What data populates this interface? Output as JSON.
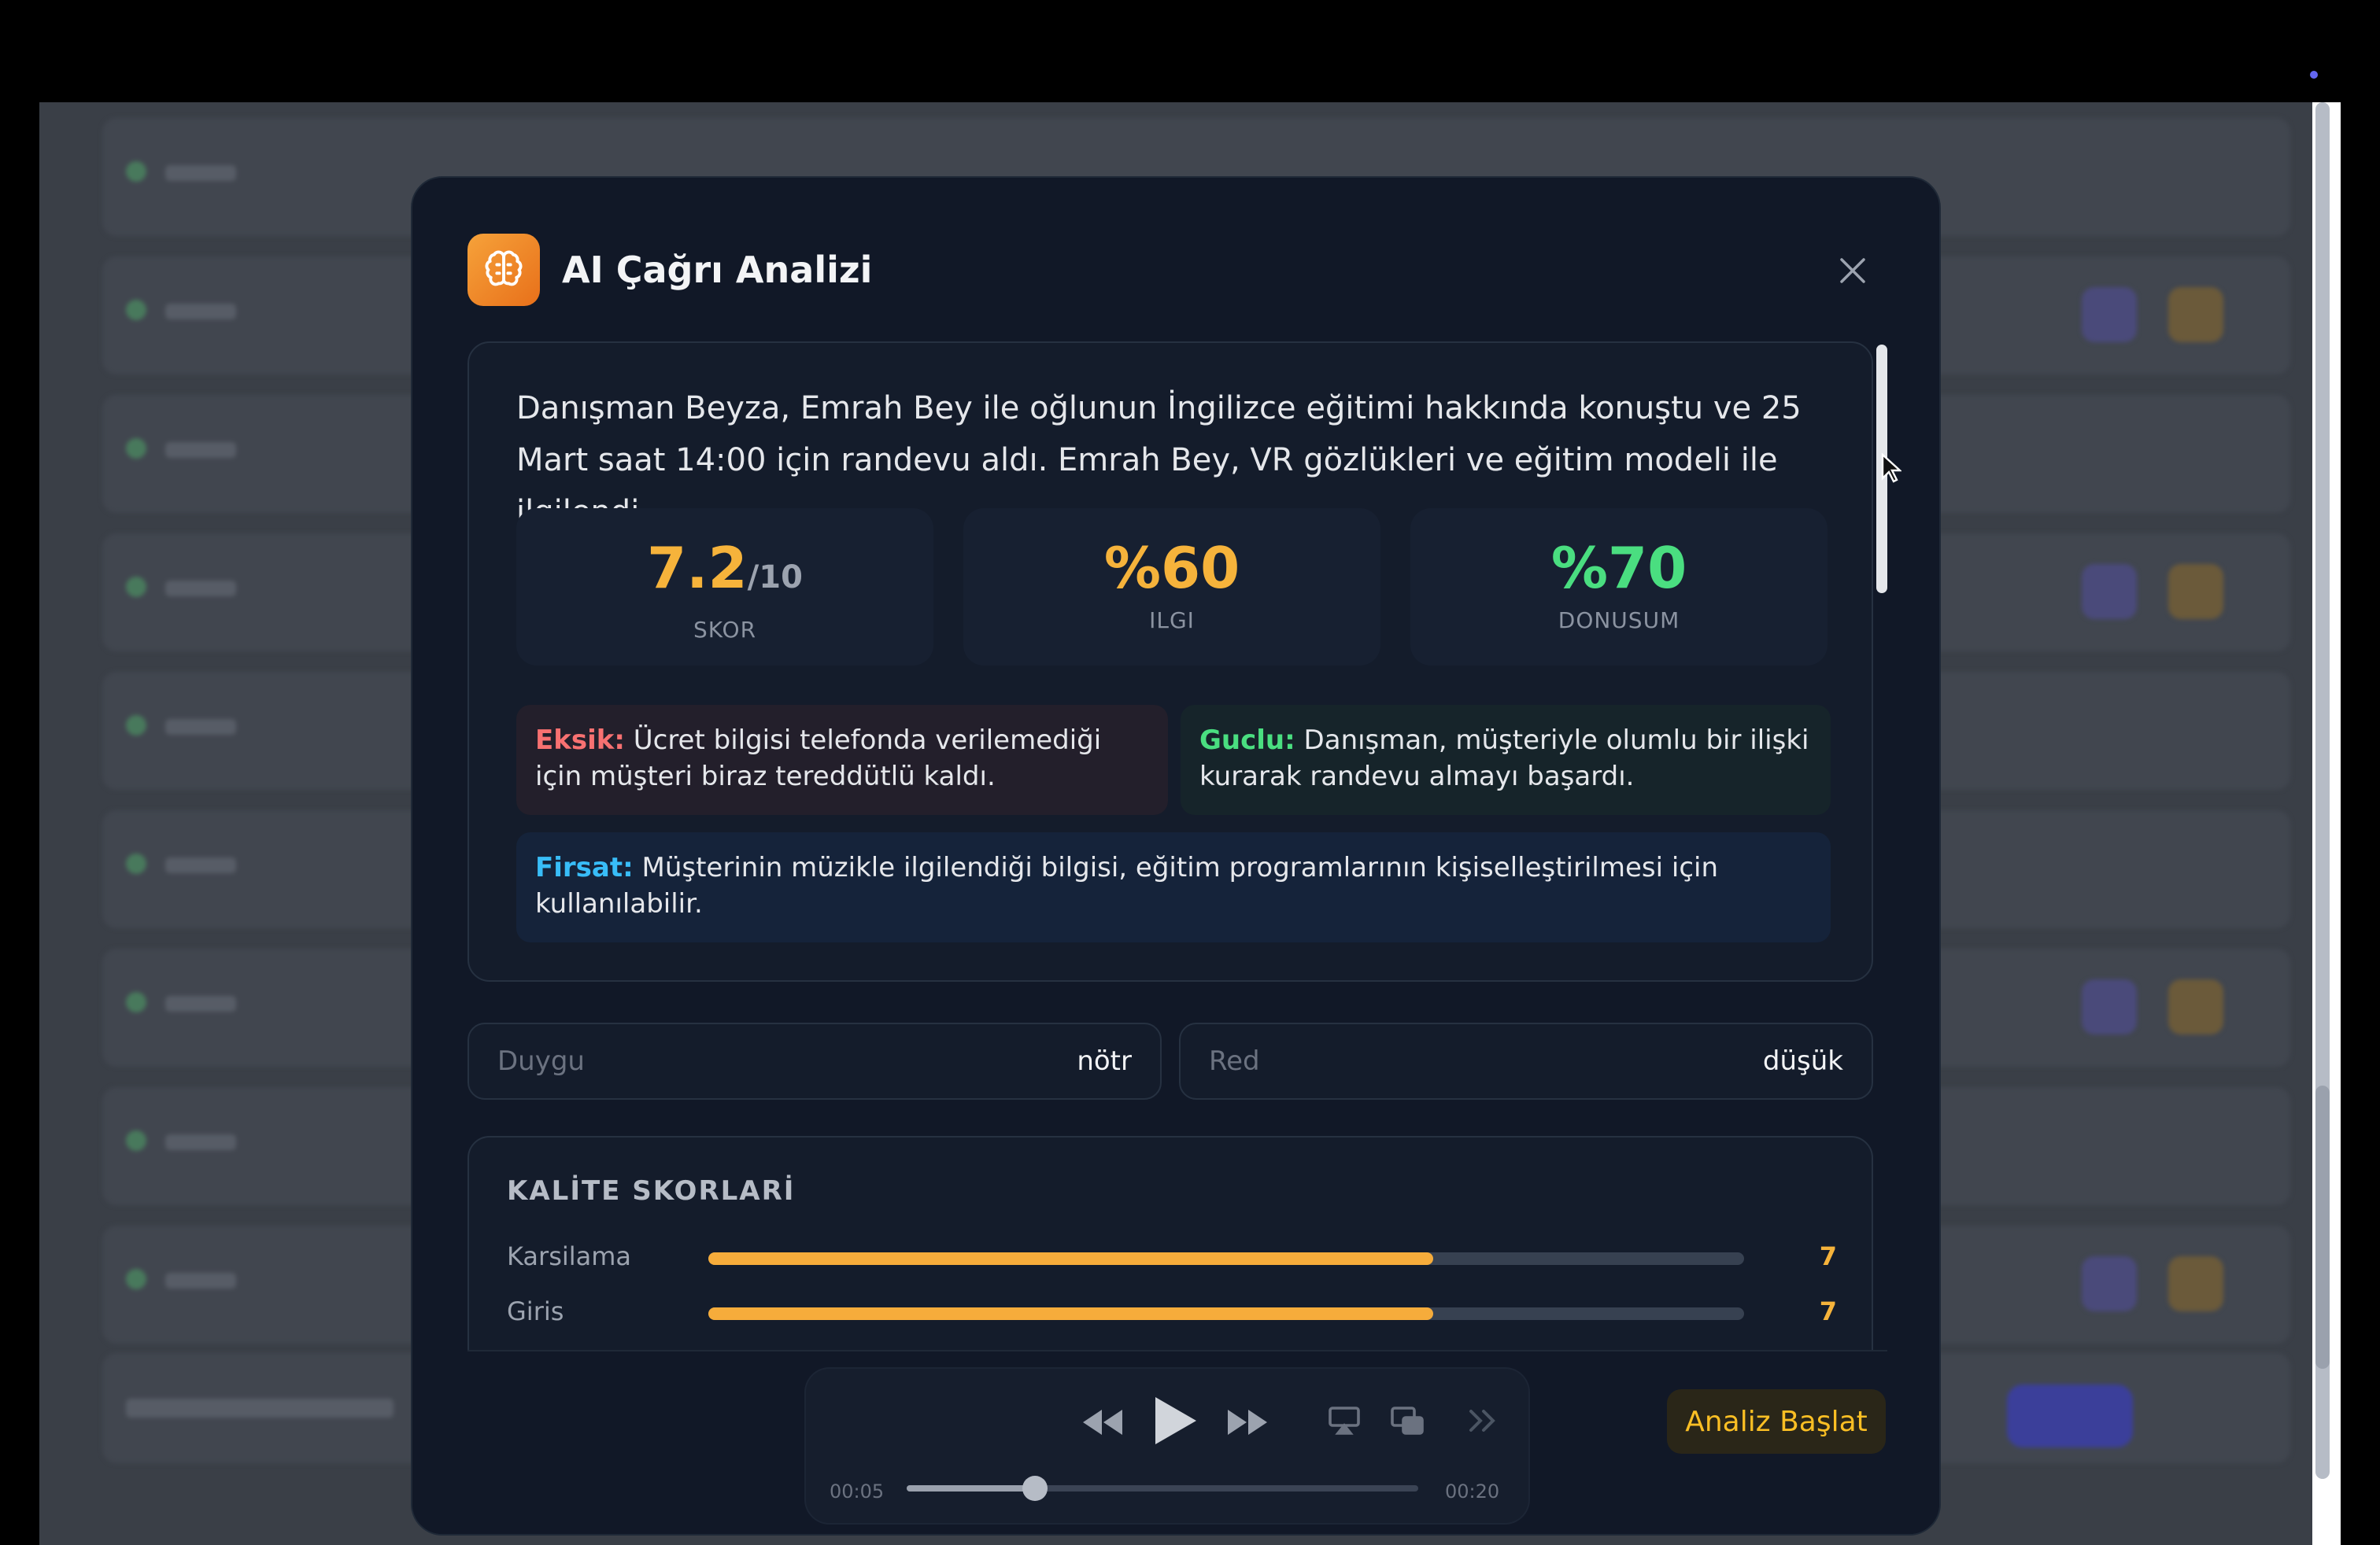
{
  "modal": {
    "title": "AI Çağrı Analizi",
    "summary": "Danışman Beyza, Emrah Bey ile oğlunun İngilizce eğitimi hakkında konuştu ve 25 Mart saat 14:00 için randevu aldı. Emrah Bey, VR gözlükleri ve eğitim modeli ile ilgilendi.",
    "stats": [
      {
        "value": "7.2",
        "suffix": "/10",
        "label": "SKOR",
        "color": "#f6b33b"
      },
      {
        "value": "%60",
        "suffix": "",
        "label": "ILGI",
        "color": "#f6b33b"
      },
      {
        "value": "%70",
        "suffix": "",
        "label": "DONUSUM",
        "color": "#4ade80"
      }
    ],
    "notes": {
      "eksik": {
        "key": "Eksik:",
        "text": "Ücret bilgisi telefonda verilemediği için müşteri biraz tereddütlü kaldı."
      },
      "guclu": {
        "key": "Guclu:",
        "text": "Danışman, müşteriyle olumlu bir ilişki kurarak randevu almayı başardı."
      },
      "firsat": {
        "key": "Firsat:",
        "text": "Müşterinin müzikle ilgilendiği bilgisi, eğitim programlarının kişiselleştirilmesi için kullanılabilir."
      }
    },
    "fields": [
      {
        "label": "Duygu",
        "value": "nötr"
      },
      {
        "label": "Red",
        "value": "düşük"
      }
    ],
    "quality": {
      "title": "KALİTE SKORLARİ",
      "max": 10,
      "items": [
        {
          "label": "Karsilama",
          "value": 7,
          "display": "7"
        },
        {
          "label": "Giris",
          "value": 7,
          "display": "7"
        }
      ]
    },
    "player": {
      "current": "00:05",
      "duration": "00:20",
      "progress": 0.25
    },
    "start_button": "Analiz Başlat"
  },
  "icons": {
    "app": "brain-icon",
    "close": "close-icon",
    "rewind": "rewind-icon",
    "play": "play-icon",
    "forward": "fast-forward-icon",
    "airplay": "airplay-icon",
    "pip": "picture-in-picture-icon",
    "skip": "double-chevron-right-icon"
  },
  "colors": {
    "accent_orange": "#f6ac3b",
    "eksik": "#f87171",
    "guclu": "#4ade80",
    "firsat": "#38bdf8"
  }
}
